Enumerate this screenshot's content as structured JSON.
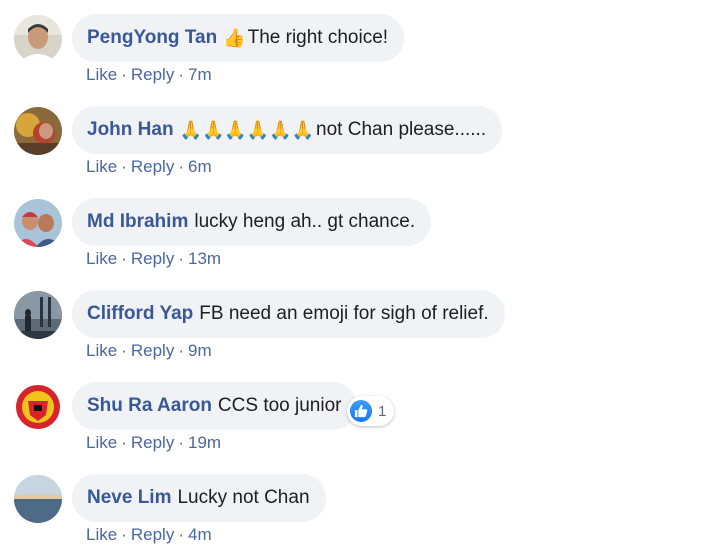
{
  "comments": [
    {
      "author": "PengYong Tan",
      "emoji": "👍",
      "text": "The right choice!",
      "like": "Like",
      "reply": "Reply",
      "time": "7m"
    },
    {
      "author": "John Han",
      "emoji": "🙏🙏🙏🙏🙏🙏",
      "text": "not Chan please......",
      "like": "Like",
      "reply": "Reply",
      "time": "6m"
    },
    {
      "author": "Md Ibrahim",
      "emoji": "",
      "text": "lucky heng ah.. gt chance.",
      "like": "Like",
      "reply": "Reply",
      "time": "13m"
    },
    {
      "author": "Clifford Yap",
      "emoji": "",
      "text": "FB need an emoji for sigh of relief.",
      "like": "Like",
      "reply": "Reply",
      "time": "9m"
    },
    {
      "author": "Shu Ra Aaron",
      "emoji": "",
      "text": "CCS too junior",
      "like": "Like",
      "reply": "Reply",
      "time": "19m",
      "reaction_count": "1"
    },
    {
      "author": "Neve Lim",
      "emoji": "",
      "text": "Lucky not Chan",
      "like": "Like",
      "reply": "Reply",
      "time": "4m"
    }
  ],
  "icons": {
    "reaction": "like-reaction-icon"
  },
  "colors": {
    "author": "#385898",
    "bubble": "#f0f2f5",
    "like_blue": "#1877f2"
  }
}
